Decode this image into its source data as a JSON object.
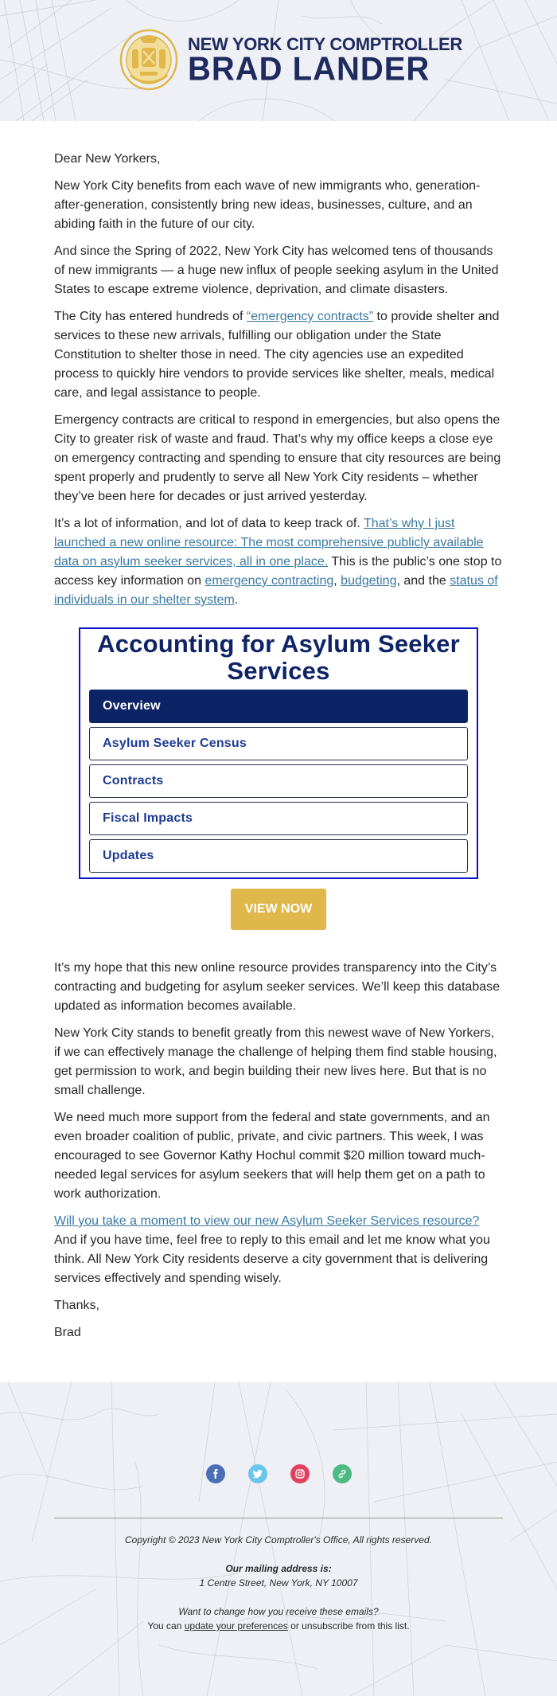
{
  "header": {
    "org_line": "NEW YORK CITY COMPTROLLER",
    "name_line": "BRAD LANDER",
    "logo_icon": "nyc-seal-icon",
    "brand_color": "#1f2a5e",
    "seal_color": "#e0b74a"
  },
  "letter": {
    "greeting": "Dear New Yorkers,",
    "p1": "New York City benefits from each wave of new immigrants who, generation-after-generation, consistently bring new ideas, businesses, culture, and an abiding faith in the future of our city.",
    "p2": "And since the Spring of 2022, New York City has welcomed tens of thousands of new immigrants — a huge new influx of people seeking asylum in the United States to escape extreme violence, deprivation, and climate disasters.",
    "p3": {
      "before": "The City has entered hundreds of ",
      "link": "“emergency contracts”",
      "after": " to provide shelter and services to these new arrivals, fulfilling our obligation under the State Constitution to shelter those in need. The city agencies use an expedited process to quickly hire vendors to provide services like shelter, meals, medical care, and legal assistance to people."
    },
    "p4": "Emergency contracts are critical to respond in emergencies, but also opens the City to greater risk of waste and fraud. That’s why my office keeps a close eye on emergency contracting and spending to ensure that city resources are being spent properly and prudently to serve all New York City residents – whether they’ve been here for decades or just arrived yesterday.",
    "p5": {
      "before": "It’s a lot of information, and lot of data to keep track of. ",
      "link_main": "That’s why I just launched a new online resource: The most comprehensive publicly available data on asylum seeker services, all in one place.",
      "middle": " This is the public’s one stop to access key information on ",
      "link_contracting": "emergency contracting",
      "sep": ", ",
      "link_budgeting": "budgeting",
      "and_the": ", and the ",
      "link_status": "status of individuals in our shelter system",
      "end": "."
    },
    "link_color": "#3a7aa3"
  },
  "card": {
    "title": "Accounting for Asylum Seeker Services",
    "nav": [
      {
        "label": "Overview",
        "active": true
      },
      {
        "label": "Asylum Seeker Census",
        "active": false
      },
      {
        "label": "Contracts",
        "active": false
      },
      {
        "label": "Fiscal Impacts",
        "active": false
      },
      {
        "label": "Updates",
        "active": false
      }
    ],
    "cta_label": "VIEW NOW",
    "border_color": "#0b14c4",
    "active_color": "#0c2466",
    "cta_color": "#e0b74a"
  },
  "letter2": {
    "p6": "It’s my hope that this new online resource provides transparency into the City’s contracting and budgeting for asylum seeker services. We’ll keep this database updated as information becomes available.",
    "p7": "New York City stands to benefit greatly from this newest wave of New Yorkers, if we can effectively manage the challenge of helping them find stable housing, get permission to work, and begin building their new lives here. But that is no small challenge.",
    "p8": "We need much more support from the federal and state governments, and an even broader coalition of public, private, and civic partners. This week, I was encouraged to see Governor Kathy Hochul commit $20 million toward much-needed legal services for asylum seekers that will help them get on a path to work authorization.",
    "p9": {
      "link": "Will you take a moment to view our new Asylum Seeker Services resource?",
      "text": "And if you have time, feel free to reply to this email and let me know what you think. All New York City residents deserve a city government that is delivering services effectively and spending wisely."
    },
    "closing": "Thanks,",
    "signature": "Brad"
  },
  "footer": {
    "socials": [
      {
        "name": "facebook",
        "icon": "facebook-icon",
        "color": "#4a6fb5"
      },
      {
        "name": "twitter",
        "icon": "twitter-icon",
        "color": "#6cc5ef"
      },
      {
        "name": "instagram",
        "icon": "instagram-icon",
        "color": "#e0405e"
      },
      {
        "name": "website",
        "icon": "link-icon",
        "color": "#4cbb83"
      }
    ],
    "copyright": "Copyright © 2023 New York City Comptroller's Office, All rights reserved.",
    "mailing_label": "Our mailing address is:",
    "address": "1 Centre Street, New York, NY 10007",
    "change_prompt": "Want to change how you receive these emails?",
    "you_can": "You can ",
    "update_prefs_link": "update your preferences",
    "unsubscribe_text": " or unsubscribe from this list."
  }
}
